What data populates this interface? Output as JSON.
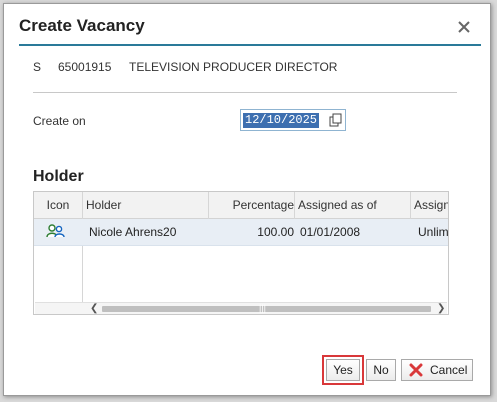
{
  "dialog": {
    "title": "Create Vacancy",
    "close_icon": "close-icon"
  },
  "position": {
    "type": "S",
    "id": "65001915",
    "title": "TELEVISION PRODUCER DIRECTOR"
  },
  "create_on": {
    "label": "Create on",
    "value": "12/10/2025",
    "picker_icon": "calendar-picker-icon"
  },
  "holder_section": {
    "title": "Holder",
    "columns": [
      "Icon",
      "Holder",
      "Percentage",
      "Assigned as of",
      "Assign"
    ],
    "rows": [
      {
        "icon": "people-icon",
        "holder": "Nicole Ahrens20",
        "percentage": "100.00",
        "assigned_as_of": "01/01/2008",
        "assign": "Unlim"
      }
    ]
  },
  "buttons": {
    "yes": "Yes",
    "no": "No",
    "cancel": "Cancel"
  },
  "colors": {
    "accent": "#2a7a99",
    "highlight": "#d9383a",
    "selection": "#3d6fb0"
  }
}
